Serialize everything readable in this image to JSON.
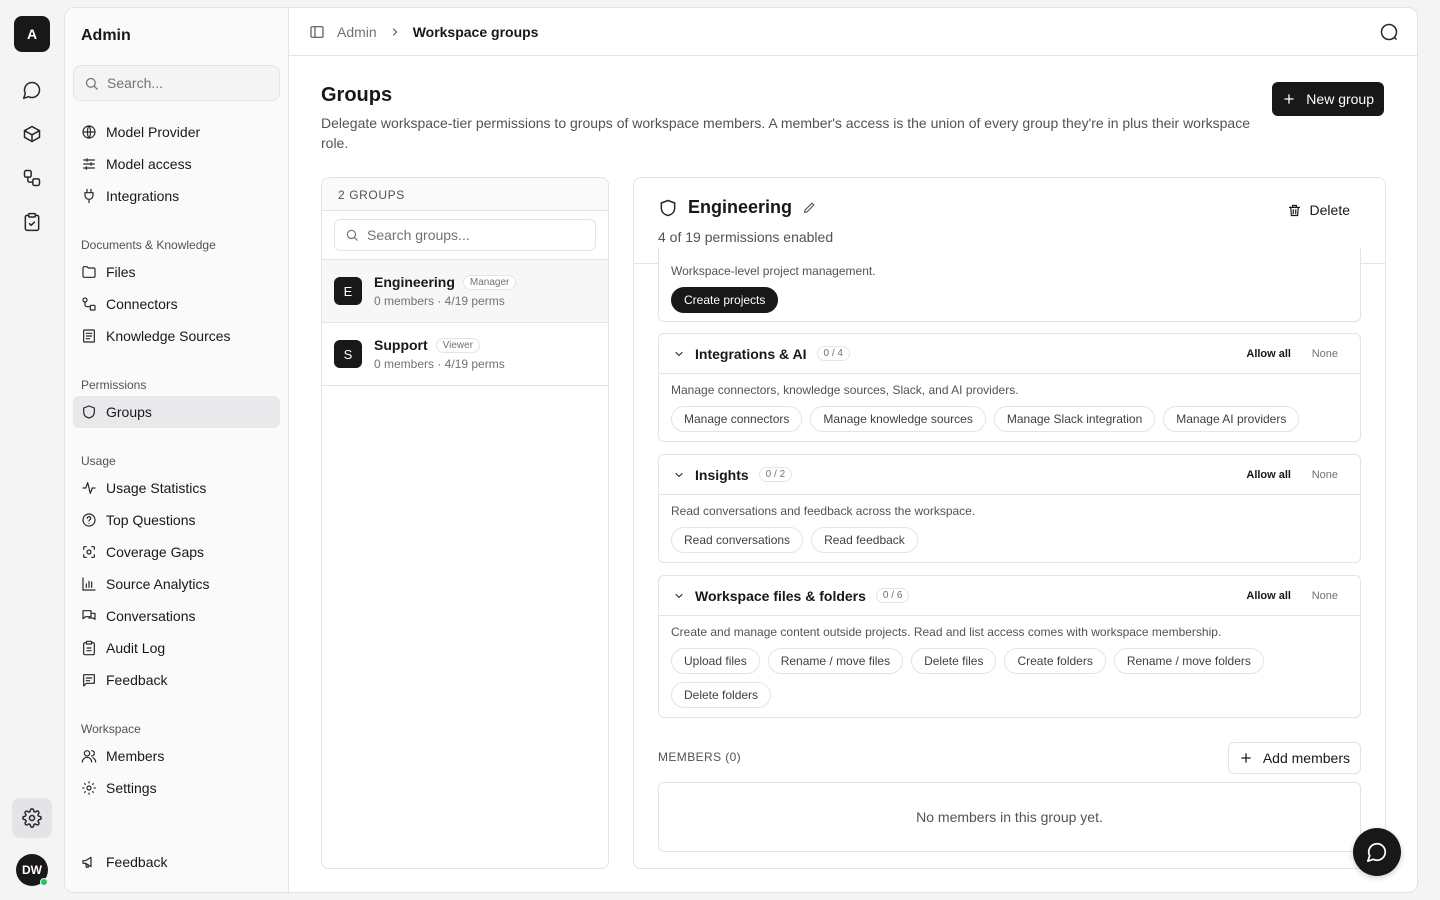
{
  "rail": {
    "logo_letter": "A",
    "icons": [
      "chat-icon",
      "cube-icon",
      "workflow-icon",
      "clipboard-check-icon"
    ],
    "avatar_initials": "DW"
  },
  "sidebar": {
    "title": "Admin",
    "search_placeholder": "Search...",
    "top_items": [
      {
        "label": "Model Provider",
        "icon": "globe-icon"
      },
      {
        "label": "Model access",
        "icon": "sliders-icon"
      },
      {
        "label": "Integrations",
        "icon": "plug-icon"
      }
    ],
    "sections": [
      {
        "title": "Documents & Knowledge",
        "items": [
          {
            "label": "Files",
            "icon": "folder-icon"
          },
          {
            "label": "Connectors",
            "icon": "connectors-icon"
          },
          {
            "label": "Knowledge Sources",
            "icon": "book-icon"
          }
        ]
      },
      {
        "title": "Permissions",
        "items": [
          {
            "label": "Groups",
            "icon": "shield-icon",
            "active": true
          }
        ]
      },
      {
        "title": "Usage",
        "items": [
          {
            "label": "Usage Statistics",
            "icon": "activity-icon"
          },
          {
            "label": "Top Questions",
            "icon": "help-circle-icon"
          },
          {
            "label": "Coverage Gaps",
            "icon": "scan-icon"
          },
          {
            "label": "Source Analytics",
            "icon": "bar-chart-icon"
          },
          {
            "label": "Conversations",
            "icon": "messages-icon"
          },
          {
            "label": "Audit Log",
            "icon": "clipboard-icon"
          },
          {
            "label": "Feedback",
            "icon": "message-square-icon"
          }
        ]
      },
      {
        "title": "Workspace",
        "items": [
          {
            "label": "Members",
            "icon": "users-icon"
          },
          {
            "label": "Settings",
            "icon": "gear-icon"
          }
        ]
      }
    ],
    "bottom_item": {
      "label": "Feedback",
      "icon": "megaphone-icon"
    }
  },
  "topbar": {
    "crumb_parent": "Admin",
    "crumb_current": "Workspace groups"
  },
  "page": {
    "title": "Groups",
    "description": "Delegate workspace-tier permissions to groups of workspace members. A member's access is the union of every group they're in plus their workspace role.",
    "new_group_label": "New group"
  },
  "groups": {
    "header": "2 GROUPS",
    "search_placeholder": "Search groups...",
    "items": [
      {
        "letter": "E",
        "name": "Engineering",
        "badge": "Manager",
        "sub": "0 members · 4/19 perms",
        "selected": true
      },
      {
        "letter": "S",
        "name": "Support",
        "badge": "Viewer",
        "sub": "0 members · 4/19 perms",
        "selected": false
      }
    ]
  },
  "detail": {
    "title": "Engineering",
    "subtitle": "4 of 19 permissions enabled",
    "delete_label": "Delete",
    "partial_card": {
      "desc": "Workspace-level project management.",
      "chips": [
        {
          "label": "Create projects",
          "on": true
        }
      ]
    },
    "cards": [
      {
        "title": "Integrations & AI",
        "count": "0 / 4",
        "allow": "Allow all",
        "none": "None",
        "desc": "Manage connectors, knowledge sources, Slack, and AI providers.",
        "chips": [
          "Manage connectors",
          "Manage knowledge sources",
          "Manage Slack integration",
          "Manage AI providers"
        ]
      },
      {
        "title": "Insights",
        "count": "0 / 2",
        "allow": "Allow all",
        "none": "None",
        "desc": "Read conversations and feedback across the workspace.",
        "chips": [
          "Read conversations",
          "Read feedback"
        ]
      },
      {
        "title": "Workspace files & folders",
        "count": "0 / 6",
        "allow": "Allow all",
        "none": "None",
        "desc": "Create and manage content outside projects. Read and list access comes with workspace membership.",
        "chips": [
          "Upload files",
          "Rename / move files",
          "Delete files",
          "Create folders",
          "Rename / move folders",
          "Delete folders"
        ]
      }
    ],
    "members_label": "MEMBERS (0)",
    "add_members_label": "Add members",
    "members_empty": "No members in this group yet."
  }
}
